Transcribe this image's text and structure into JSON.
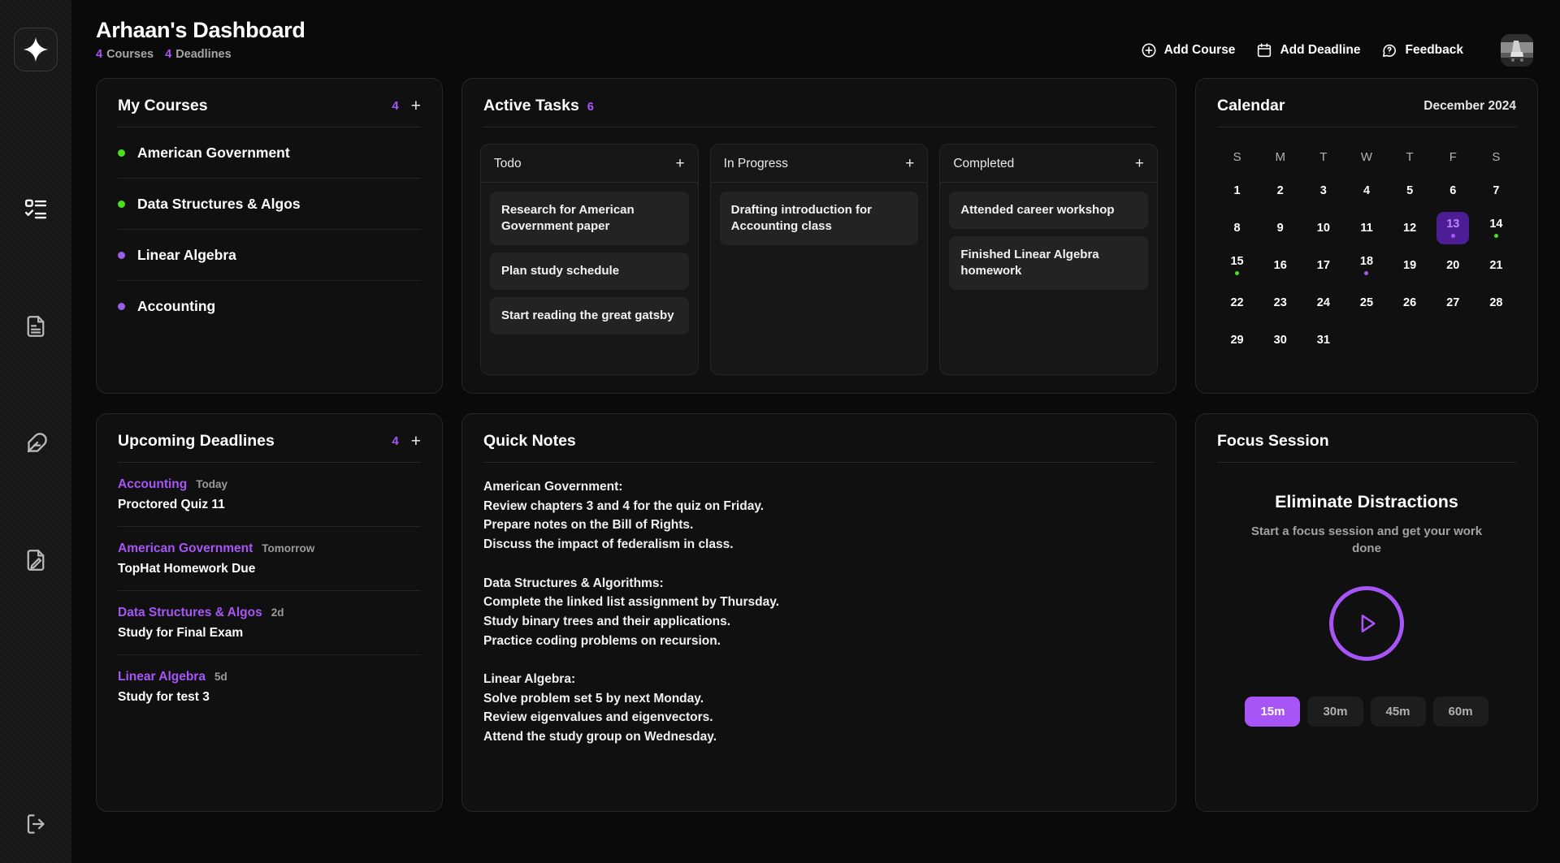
{
  "sidebar": {
    "logo": "sparkle-logo",
    "items": [
      {
        "icon": "checklist-icon",
        "active": true
      },
      {
        "icon": "document-icon",
        "active": false
      },
      {
        "icon": "feather-pen-icon",
        "active": false
      },
      {
        "icon": "document-edit-icon",
        "active": false
      }
    ],
    "logout": {
      "icon": "logout-icon"
    }
  },
  "header": {
    "title": "Arhaan's Dashboard",
    "stats": [
      {
        "num": "4",
        "label": "Courses"
      },
      {
        "num": "4",
        "label": "Deadlines"
      }
    ],
    "actions": [
      {
        "label": "Add Course",
        "icon": "plus-circle-icon"
      },
      {
        "label": "Add Deadline",
        "icon": "calendar-icon"
      },
      {
        "label": "Feedback",
        "icon": "chat-question-icon"
      }
    ],
    "avatar": "user-avatar"
  },
  "colors": {
    "accent": "#a855f7",
    "green": "#4ade1f",
    "today_bg": "#4c1d95",
    "today_text": "#c084fc",
    "card_bg": "#101010",
    "page_bg": "#0a0a0a",
    "sidebar_bg": "#181818"
  },
  "courses_card": {
    "title": "My Courses",
    "count": "4",
    "add_label": "+",
    "items": [
      {
        "name": "American Government",
        "color": "#4ade1f"
      },
      {
        "name": "Data Structures & Algos",
        "color": "#4ade1f"
      },
      {
        "name": "Linear Algebra",
        "color": "#9b5de5"
      },
      {
        "name": "Accounting",
        "color": "#9b5de5"
      }
    ]
  },
  "tasks_card": {
    "title": "Active Tasks",
    "count": "6",
    "columns": [
      {
        "title": "Todo",
        "add_label": "+",
        "tasks": [
          "Research for American Government paper",
          "Plan study schedule",
          "Start reading the great gatsby"
        ]
      },
      {
        "title": "In Progress",
        "add_label": "+",
        "tasks": [
          "Drafting introduction for Accounting class"
        ]
      },
      {
        "title": "Completed",
        "add_label": "+",
        "tasks": [
          "Attended career workshop",
          "Finished Linear Algebra homework"
        ]
      }
    ]
  },
  "calendar_card": {
    "title": "Calendar",
    "month": "December 2024",
    "dow": [
      "S",
      "M",
      "T",
      "W",
      "T",
      "F",
      "S"
    ],
    "lead_blanks": 0,
    "days": [
      {
        "n": "1"
      },
      {
        "n": "2"
      },
      {
        "n": "3"
      },
      {
        "n": "4"
      },
      {
        "n": "5"
      },
      {
        "n": "6"
      },
      {
        "n": "7"
      },
      {
        "n": "8"
      },
      {
        "n": "9"
      },
      {
        "n": "10"
      },
      {
        "n": "11"
      },
      {
        "n": "12"
      },
      {
        "n": "13",
        "today": true,
        "dot": "#a855f7"
      },
      {
        "n": "14",
        "dot": "#4ade1f"
      },
      {
        "n": "15",
        "dot": "#4ade1f"
      },
      {
        "n": "16"
      },
      {
        "n": "17"
      },
      {
        "n": "18",
        "dot": "#9b5de5"
      },
      {
        "n": "19"
      },
      {
        "n": "20"
      },
      {
        "n": "21"
      },
      {
        "n": "22"
      },
      {
        "n": "23"
      },
      {
        "n": "24"
      },
      {
        "n": "25"
      },
      {
        "n": "26"
      },
      {
        "n": "27"
      },
      {
        "n": "28"
      },
      {
        "n": "29"
      },
      {
        "n": "30"
      },
      {
        "n": "31"
      }
    ]
  },
  "deadlines_card": {
    "title": "Upcoming Deadlines",
    "count": "4",
    "add_label": "+",
    "items": [
      {
        "course": "Accounting",
        "when": "Today",
        "title": "Proctored Quiz 11"
      },
      {
        "course": "American Government",
        "when": "Tomorrow",
        "title": "TopHat Homework Due"
      },
      {
        "course": "Data Structures & Algos",
        "when": "2d",
        "title": "Study for Final Exam"
      },
      {
        "course": "Linear Algebra",
        "when": "5d",
        "title": "Study for test 3"
      }
    ]
  },
  "notes_card": {
    "title": "Quick Notes",
    "body": "American Government:\nReview chapters 3 and 4 for the quiz on Friday.\nPrepare notes on the Bill of Rights.\nDiscuss the impact of federalism in class.\n\nData Structures & Algorithms:\nComplete the linked list assignment by Thursday.\nStudy binary trees and their applications.\nPractice coding problems on recursion.\n\nLinear Algebra:\nSolve problem set 5 by next Monday.\nReview eigenvalues and eigenvectors.\nAttend the study group on Wednesday."
  },
  "focus_card": {
    "title": "Focus Session",
    "heading": "Eliminate Distractions",
    "subtext": "Start a focus session and get your work done",
    "play_icon": "play-icon",
    "durations": [
      {
        "label": "15m",
        "selected": true
      },
      {
        "label": "30m",
        "selected": false
      },
      {
        "label": "45m",
        "selected": false
      },
      {
        "label": "60m",
        "selected": false
      }
    ]
  }
}
